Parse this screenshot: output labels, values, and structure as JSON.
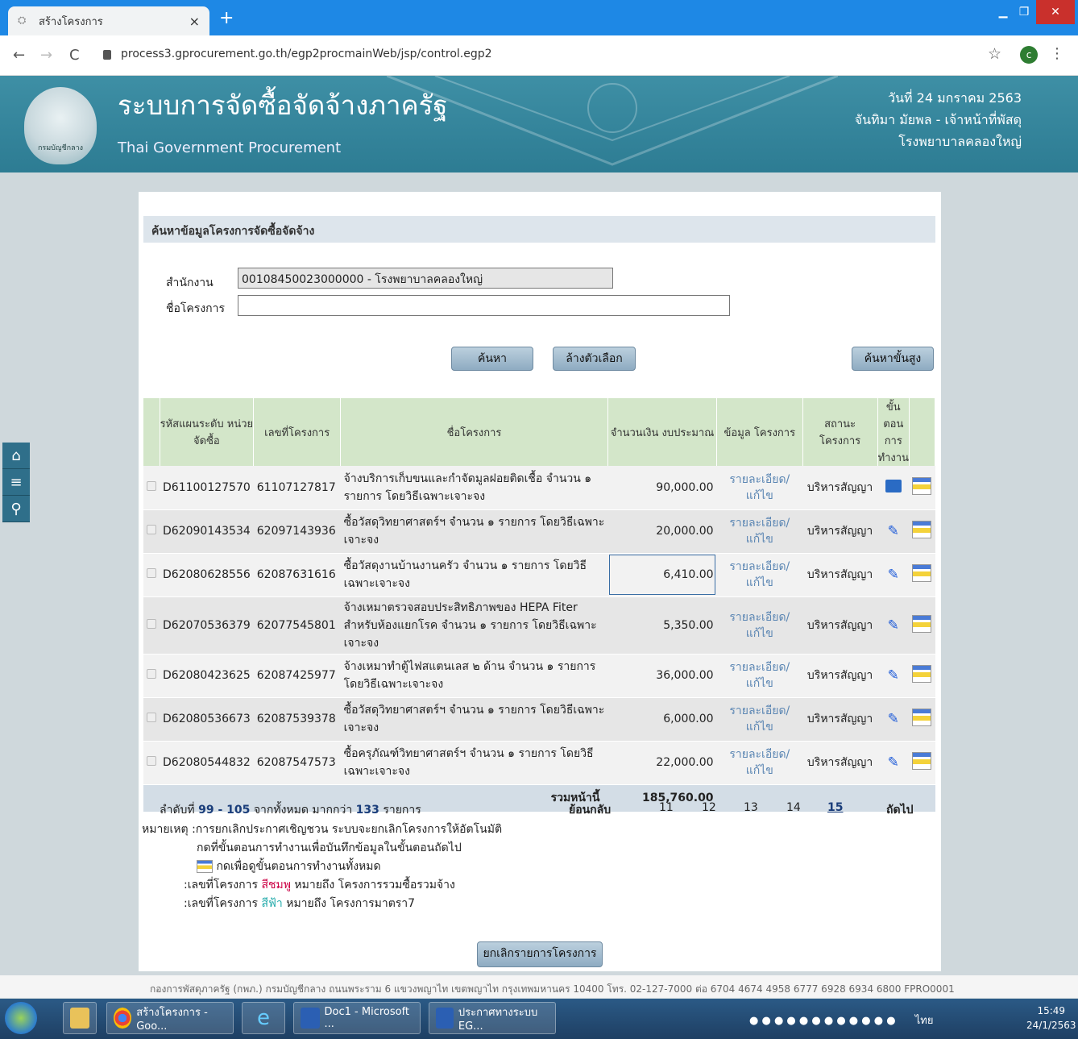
{
  "browser": {
    "tab_title": "สร้างโครงการ",
    "tab_close": "×",
    "new_tab": "+",
    "url": "process3.gprocurement.go.th/egp2procmainWeb/jsp/control.egp2",
    "profile_initial": "c"
  },
  "header": {
    "title": "ระบบการจัดซื้อจัดจ้างภาครัฐ",
    "subtitle": "Thai Government Procurement",
    "emblem_text": "กรมบัญชีกลาง",
    "date": "วันที่ 24 มกราคม 2563",
    "user": "จันทิมา มัยพล - เจ้าหน้าที่พัสดุ",
    "org": "โรงพยาบาลคลองใหญ่"
  },
  "search": {
    "section_title": "ค้นหาข้อมูลโครงการจัดซื้อจัดจ้าง",
    "office_label": "สำนักงาน",
    "office_value": "00108450023000000 - โรงพยาบาลคลองใหญ่",
    "project_label": "ชื่อโครงการ",
    "project_value": "",
    "search_button": "ค้นหา",
    "clear_button": "ล้างตัวเลือก",
    "advanced_button": "ค้นหาขั้นสูง"
  },
  "table": {
    "headers": [
      "รหัสแผนระดับ หน่วยจัดซื้อ",
      "เลขที่โครงการ",
      "ชื่อโครงการ",
      "จำนวนเงิน งบประมาณ",
      "ข้อมูล โครงการ",
      "สถานะ โครงการ",
      "ขั้น ตอน การ ทำงาน"
    ],
    "rows": [
      {
        "plan": "D61100127570",
        "project_no": "61107127817",
        "name": "จ้างบริการเก็บขนและกำจัดมูลฝอยติดเชื้อ จำนวน ๑ รายการ โดยวิธีเฉพาะเจาะจง",
        "amount": "90,000.00",
        "detail": "รายละเอียด/แก้ไข",
        "status": "บริหารสัญญา",
        "step_icon": "book-icon"
      },
      {
        "plan": "D62090143534",
        "project_no": "62097143936",
        "name": "ซื้อวัสดุวิทยาศาสตร์ฯ จำนวน ๑ รายการ โดยวิธีเฉพาะเจาะจง",
        "amount": "20,000.00",
        "detail": "รายละเอียด/แก้ไข",
        "status": "บริหารสัญญา",
        "step_icon": "pencil-icon"
      },
      {
        "plan": "D62080628556",
        "project_no": "62087631616",
        "name": "ซื้อวัสดุงานบ้านงานครัว จำนวน ๑ รายการ โดยวิธีเฉพาะเจาะจง",
        "amount": "6,410.00",
        "detail": "รายละเอียด/แก้ไข",
        "status": "บริหารสัญญา",
        "step_icon": "pencil-icon"
      },
      {
        "plan": "D62070536379",
        "project_no": "62077545801",
        "name": "จ้างเหมาตรวจสอบประสิทธิภาพของ HEPA Fiter สำหรับห้องแยกโรค จำนวน ๑ รายการ โดยวิธีเฉพาะเจาะจง",
        "amount": "5,350.00",
        "detail": "รายละเอียด/แก้ไข",
        "status": "บริหารสัญญา",
        "step_icon": "pencil-icon"
      },
      {
        "plan": "D62080423625",
        "project_no": "62087425977",
        "name": "จ้างเหมาทำตู้ไฟสแตนเลส ๒ ด้าน จำนวน ๑ รายการ โดยวิธีเฉพาะเจาะจง",
        "amount": "36,000.00",
        "detail": "รายละเอียด/แก้ไข",
        "status": "บริหารสัญญา",
        "step_icon": "pencil-icon"
      },
      {
        "plan": "D62080536673",
        "project_no": "62087539378",
        "name": "ซื้อวัสดุวิทยาศาสตร์ฯ จำนวน ๑ รายการ โดยวิธีเฉพาะเจาะจง",
        "amount": "6,000.00",
        "detail": "รายละเอียด/แก้ไข",
        "status": "บริหารสัญญา",
        "step_icon": "pencil-icon"
      },
      {
        "plan": "D62080544832",
        "project_no": "62087547573",
        "name": "ซื้อครุภัณฑ์วิทยาศาสตร์ฯ จำนวน ๑ รายการ โดยวิธีเฉพาะเจาะจง",
        "amount": "22,000.00",
        "detail": "รายละเอียด/แก้ไข",
        "status": "บริหารสัญญา",
        "step_icon": "pencil-icon"
      }
    ],
    "total_label": "รวมหน้านี้",
    "total_value": "185,760.00"
  },
  "pagination": {
    "range_prefix": "ลำดับที่",
    "range": "99 - 105",
    "range_mid": "จากทั้งหมด มากกว่า",
    "total": "133",
    "range_suffix": "รายการ",
    "back": "ย้อนกลับ",
    "pages": [
      "11",
      "12",
      "13",
      "14",
      "15"
    ],
    "current": "15",
    "next": "ถัดไป"
  },
  "notes": {
    "line1": "หมายเหตุ :การยกเลิกประกาศเชิญชวน ระบบจะยกเลิกโครงการให้อัตโนมัติ",
    "line2": "กดที่ขั้นตอนการทำงานเพื่อบันทึกข้อมูลในขั้นตอนถัดไป",
    "line3": "กดเพื่อดูขั้นตอนการทำงานทั้งหมด",
    "line4_prefix": ":เลขที่โครงการ",
    "line4_color": "สีชมพู",
    "line4_suffix": "หมายถึง โครงการรวมซื้อรวมจ้าง",
    "line5_prefix": ":เลขที่โครงการ",
    "line5_color": "สีฟ้า",
    "line5_suffix": "หมายถึง โครงการมาตรา7"
  },
  "cancel_button": "ยกเลิกรายการโครงการ",
  "footer": "กองการพัสดุภาครัฐ (กพภ.) กรมบัญชีกลาง ถนนพระราม 6 แขวงพญาไท เขตพญาไท กรุงเทพมหานคร 10400 โทร. 02-127-7000 ต่อ 6704 4674 4958 6777 6928 6934 6800 FPRO0001",
  "taskbar": {
    "items": [
      "สร้างโครงการ - Goo...",
      "Doc1 - Microsoft ...",
      "ประกาศทางระบบ EG..."
    ],
    "lang": "ไทย",
    "time": "15:49",
    "date": "24/1/2563"
  }
}
